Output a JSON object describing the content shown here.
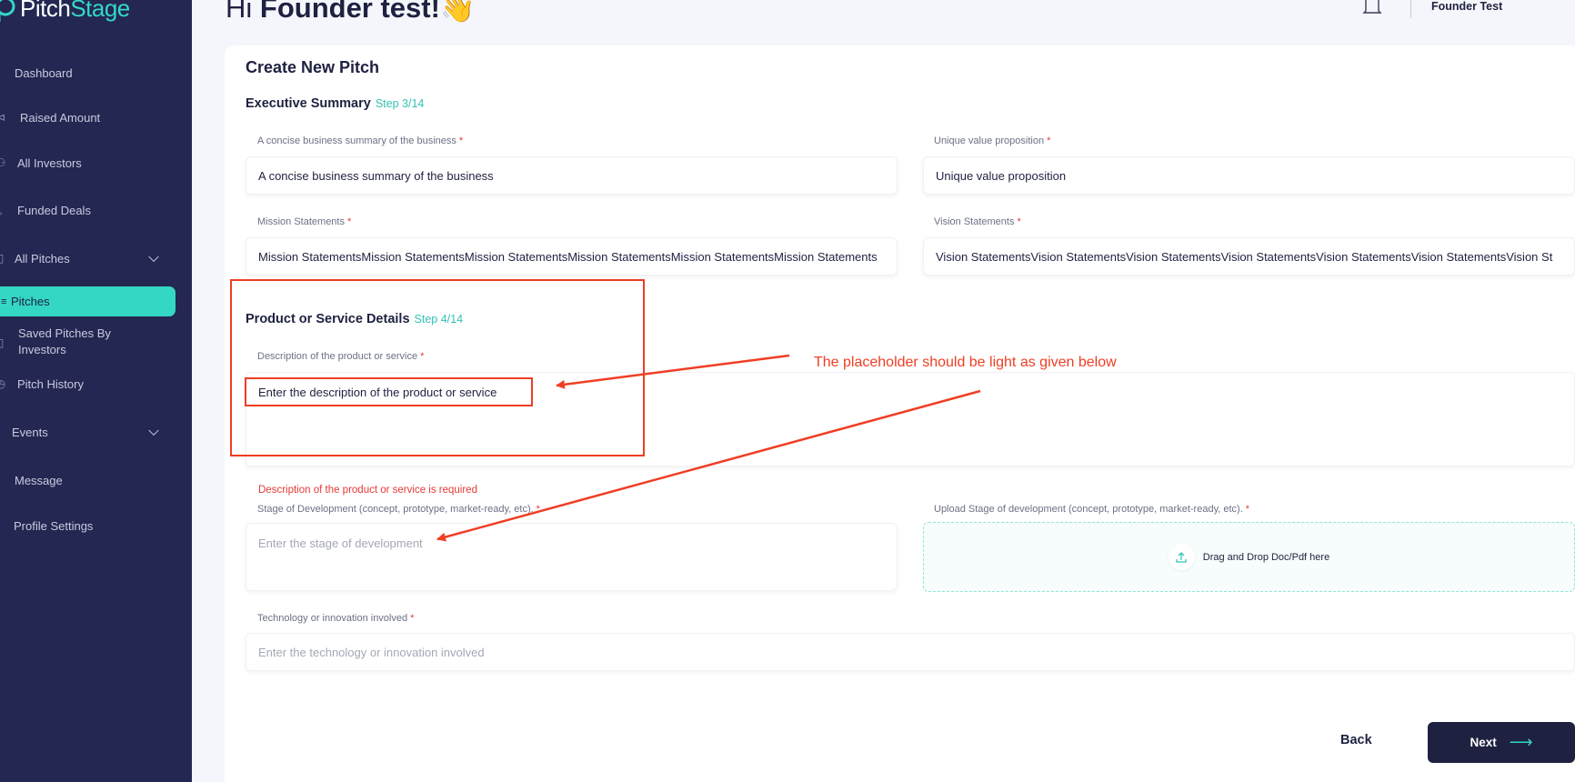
{
  "brand": {
    "name_part1": "Pitch",
    "name_part2": "Stage"
  },
  "sidebar": {
    "items": [
      {
        "label": "Dashboard",
        "icon": "grid-icon"
      },
      {
        "label": "Raised Amount",
        "icon": "megaphone-icon"
      },
      {
        "label": "All Investors",
        "icon": "users-icon"
      },
      {
        "label": "Funded Deals",
        "icon": "handshake-icon"
      },
      {
        "label": "All Pitches",
        "icon": "folder-icon",
        "expandable": true
      },
      {
        "label": "Pitches",
        "icon": "list-icon",
        "active": true
      },
      {
        "label": "Saved Pitches By Investors",
        "icon": "bookmark-icon"
      },
      {
        "label": "Pitch History",
        "icon": "history-icon"
      },
      {
        "label": "Events",
        "icon": "calendar-icon",
        "expandable": true
      },
      {
        "label": "Message",
        "icon": "message-icon"
      },
      {
        "label": "Profile Settings",
        "icon": "user-settings-icon"
      }
    ]
  },
  "header": {
    "greeting_prefix": "Hi ",
    "greeting_name": "Founder test!",
    "greeting_emoji": "👋",
    "user_name": "Founder Test"
  },
  "form": {
    "title": "Create New Pitch",
    "executive_summary": {
      "title": "Executive Summary",
      "step": "Step 3/14",
      "business_summary": {
        "label": "A concise business summary of the business",
        "value": "A concise business summary of the business"
      },
      "value_proposition": {
        "label": "Unique value proposition",
        "value": "Unique value proposition"
      },
      "mission": {
        "label": "Mission Statements",
        "value": "Mission StatementsMission StatementsMission StatementsMission StatementsMission StatementsMission Statements"
      },
      "vision": {
        "label": "Vision Statements",
        "value": "Vision StatementsVision StatementsVision StatementsVision StatementsVision StatementsVision StatementsVision St"
      }
    },
    "product_details": {
      "title": "Product or Service Details",
      "step": "Step 4/14",
      "description": {
        "label": "Description of the product or service",
        "value": "Enter the description of the product or service",
        "error": "Description of the product or service is required"
      },
      "stage": {
        "label": "Stage of Development (concept, prototype, market-ready, etc).",
        "placeholder": "Enter the stage of development"
      },
      "upload": {
        "label": "Upload Stage of development (concept, prototype, market-ready, etc).",
        "text": "Drag and Drop Doc/Pdf here"
      },
      "technology": {
        "label": "Technology or innovation involved",
        "placeholder": "Enter the technology or innovation involved"
      }
    },
    "required_mark": "*",
    "back_label": "Back",
    "next_label": "Next",
    "next_arrow": "⟶"
  },
  "annotation": {
    "text": "The placeholder should be light as given below",
    "color": "#ef3e24"
  },
  "colors": {
    "sidebar_bg": "#232751",
    "accent": "#34d7c4",
    "primary_dark": "#1e2140",
    "error": "#e53935"
  }
}
